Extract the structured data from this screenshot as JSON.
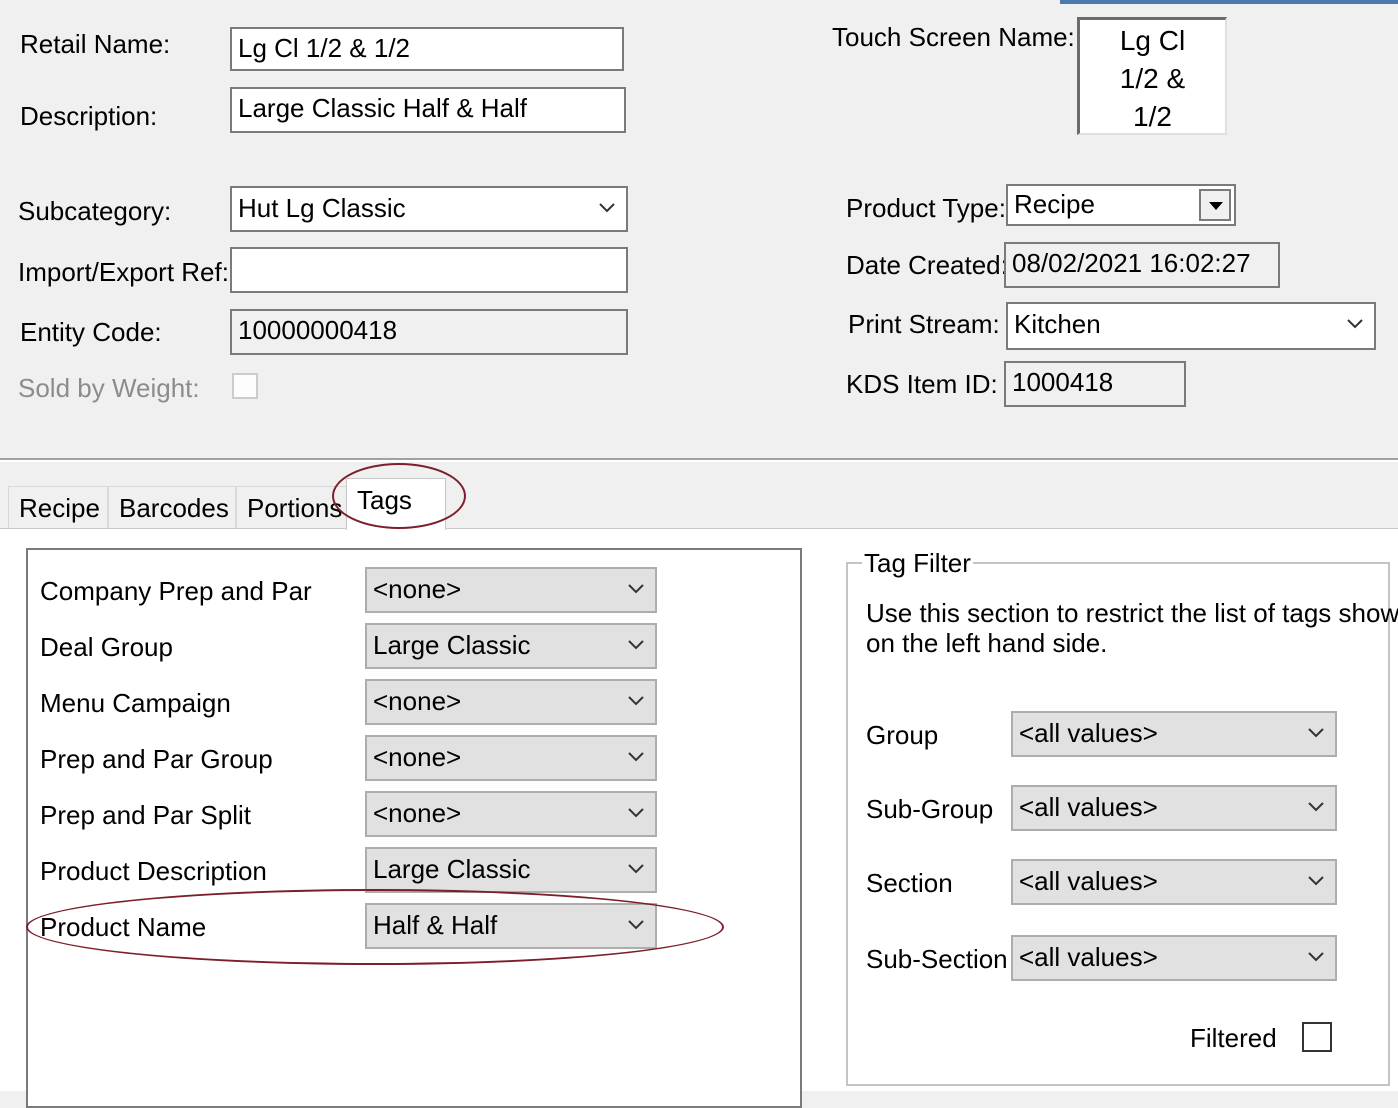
{
  "header": {
    "retail_name_label": "Retail Name:",
    "retail_name_value": "Lg Cl 1/2 & 1/2",
    "description_label": "Description:",
    "description_value": "Large Classic Half & Half",
    "touch_screen_label": "Touch Screen Name:",
    "touch_screen_lines": [
      "Lg Cl",
      "1/2 &",
      "1/2"
    ],
    "subcategory_label": "Subcategory:",
    "subcategory_value": "Hut Lg Classic",
    "import_export_label": "Import/Export Ref:",
    "import_export_value": "",
    "entity_code_label": "Entity Code:",
    "entity_code_value": "10000000418",
    "sold_by_weight_label": "Sold by Weight:",
    "product_type_label": "Product Type:",
    "product_type_value": "Recipe",
    "date_created_label": "Date Created:",
    "date_created_value": "08/02/2021 16:02:27",
    "print_stream_label": "Print Stream:",
    "print_stream_value": "Kitchen",
    "kds_label": "KDS Item ID:",
    "kds_value": "1000418"
  },
  "tabs": [
    {
      "label": "Recipe"
    },
    {
      "label": "Barcodes"
    },
    {
      "label": "Portions"
    },
    {
      "label": "Tags",
      "active": true
    }
  ],
  "tags": [
    {
      "label": "Company Prep and Par",
      "value": "<none>"
    },
    {
      "label": "Deal Group",
      "value": "Large Classic"
    },
    {
      "label": "Menu Campaign",
      "value": "<none>"
    },
    {
      "label": "Prep and Par Group",
      "value": "<none>"
    },
    {
      "label": "Prep and Par Split",
      "value": "<none>"
    },
    {
      "label": "Product Description",
      "value": "Large Classic"
    },
    {
      "label": "Product Name",
      "value": "Half & Half"
    }
  ],
  "tag_filter": {
    "title": "Tag Filter",
    "description_line1": "Use this section to restrict the list of tags shown",
    "description_line2": "on the left hand side.",
    "filters": [
      {
        "label": "Group",
        "value": "<all values>"
      },
      {
        "label": "Sub-Group",
        "value": "<all values>"
      },
      {
        "label": "Section",
        "value": "<all values>"
      },
      {
        "label": "Sub-Section",
        "value": "<all values>"
      }
    ],
    "filtered_label": "Filtered",
    "filtered_checked": false
  },
  "colors": {
    "annotation": "#7b1f2b",
    "accent": "#4d78b0"
  }
}
